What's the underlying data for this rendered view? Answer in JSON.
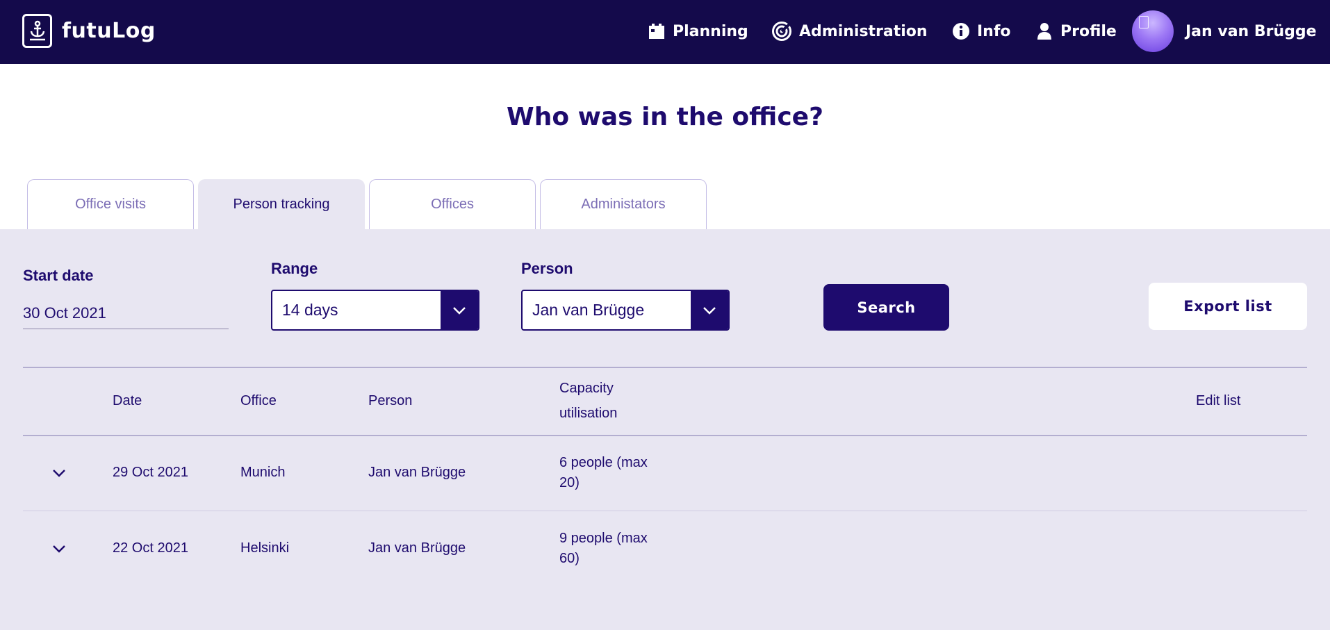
{
  "app": {
    "name": "futuLog"
  },
  "nav": {
    "planning": "Planning",
    "administration": "Administration",
    "info": "Info",
    "profile": "Profile",
    "user_name": "Jan van Brügge"
  },
  "page": {
    "title": "Who was in the office?"
  },
  "tabs": [
    {
      "label": "Office visits",
      "active": false
    },
    {
      "label": "Person tracking",
      "active": true
    },
    {
      "label": "Offices",
      "active": false
    },
    {
      "label": "Administators",
      "active": false
    }
  ],
  "filters": {
    "start_date_label": "Start date",
    "start_date_value": "30 Oct 2021",
    "range_label": "Range",
    "range_value": "14 days",
    "person_label": "Person",
    "person_value": "Jan van Brügge",
    "search_label": "Search",
    "export_label": "Export list"
  },
  "table": {
    "headers": {
      "date": "Date",
      "office": "Office",
      "person": "Person",
      "capacity_line1": "Capacity",
      "capacity_line2": "utilisation",
      "edit": "Edit list"
    },
    "rows": [
      {
        "date": "29 Oct 2021",
        "office": "Munich",
        "person": "Jan van Brügge",
        "capacity_line1": "6 people (max",
        "capacity_line2": "20)"
      },
      {
        "date": "22 Oct 2021",
        "office": "Helsinki",
        "person": "Jan van Brügge",
        "capacity_line1": "9 people (max",
        "capacity_line2": "60)"
      }
    ]
  },
  "colors": {
    "header_bg": "#140a4b",
    "primary": "#1e0b6e",
    "panel_bg": "#e8e6f2",
    "tab_inactive_text": "#7b6db5"
  }
}
